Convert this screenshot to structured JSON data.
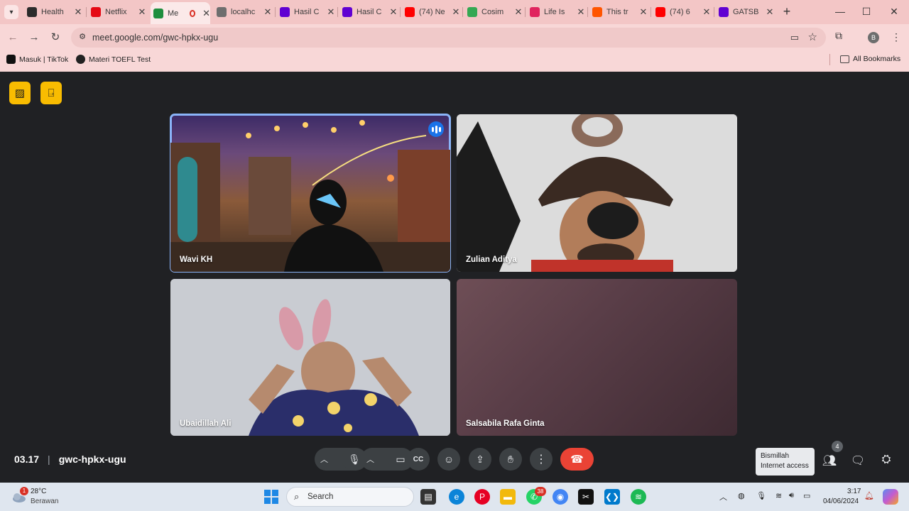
{
  "tabs": [
    {
      "title": "Health",
      "color": "#2b2b2b"
    },
    {
      "title": "Netflix",
      "color": "#e50914"
    },
    {
      "title": "Me",
      "color": "#1e8e3e",
      "active": true
    },
    {
      "title": "localhc",
      "color": "#6e6e6e"
    },
    {
      "title": "Hasil C",
      "color": "#6001d2"
    },
    {
      "title": "Hasil C",
      "color": "#6001d2"
    },
    {
      "title": "(74) Ne",
      "color": "#ff0000"
    },
    {
      "title": "Cosim",
      "color": "#34a853"
    },
    {
      "title": "Life Is",
      "color": "#e0245e"
    },
    {
      "title": "This tr",
      "color": "#ff5500"
    },
    {
      "title": "(74) 6",
      "color": "#ff0000"
    },
    {
      "title": "GATSB",
      "color": "#6001d2"
    }
  ],
  "address": {
    "url": "meet.google.com/gwc-hpkx-ugu"
  },
  "profile_initial": "B",
  "bookmarks": [
    {
      "label": "Masuk | TikTok"
    },
    {
      "label": "Materi TOEFL Test"
    }
  ],
  "all_bookmarks": "All Bookmarks",
  "participants": [
    {
      "name": "Wavi KH"
    },
    {
      "name": "Zulian Aditya"
    },
    {
      "name": "Ubaidillah Ali"
    },
    {
      "name": "Salsabila Rafa Ginta"
    }
  ],
  "meeting": {
    "time": "03.17",
    "separator": "|",
    "code": "gwc-hpkx-ugu"
  },
  "tooltip": {
    "line1": "Bismillah",
    "line2": "Internet access"
  },
  "people_count": "4",
  "weather": {
    "temp": "28°C",
    "condition": "Berawan",
    "badge": "1"
  },
  "taskbar": {
    "search_label": "Search",
    "whatsapp_badge": "38"
  },
  "clock": {
    "time": "3:17",
    "date": "04/06/2024"
  },
  "colors": {
    "accent": "#8ab4f8",
    "end_call": "#ea4335",
    "tool_yellow": "#f9bc01"
  }
}
